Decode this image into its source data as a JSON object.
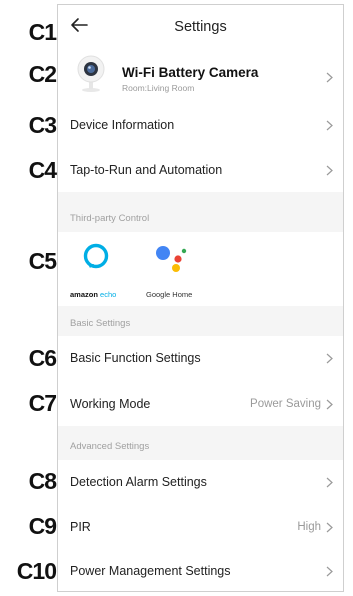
{
  "callouts": [
    "C1",
    "C2",
    "C3",
    "C4",
    "C5",
    "C6",
    "C7",
    "C8",
    "C9",
    "C10"
  ],
  "header": {
    "title": "Settings",
    "back_icon": "arrow-left-icon"
  },
  "device": {
    "name": "Wi-Fi Battery Camera",
    "room": "Room:Living Room",
    "icon": "camera-icon"
  },
  "rows": {
    "device_info": "Device Information",
    "tap_to_run": "Tap-to-Run and Automation",
    "basic_function": "Basic Function Settings",
    "working_mode": {
      "label": "Working Mode",
      "value": "Power Saving"
    },
    "detection_alarm": "Detection Alarm Settings",
    "pir": {
      "label": "PIR",
      "value": "High"
    },
    "power_mgmt": "Power Management Settings"
  },
  "sections": {
    "third_party": "Third-party Control",
    "basic": "Basic Settings",
    "advanced": "Advanced Settings"
  },
  "third_party": {
    "alexa": {
      "label_a": "amazon",
      "label_b": "echo"
    },
    "google": {
      "label_a": "Google",
      "label_b": "Home"
    }
  },
  "colors": {
    "alexa_blue": "#00aee5",
    "google_blue": "#4285f4",
    "google_red": "#ea4335",
    "google_yellow": "#fbbc05",
    "google_green": "#34a853",
    "section_bg": "#f5f5f5"
  }
}
